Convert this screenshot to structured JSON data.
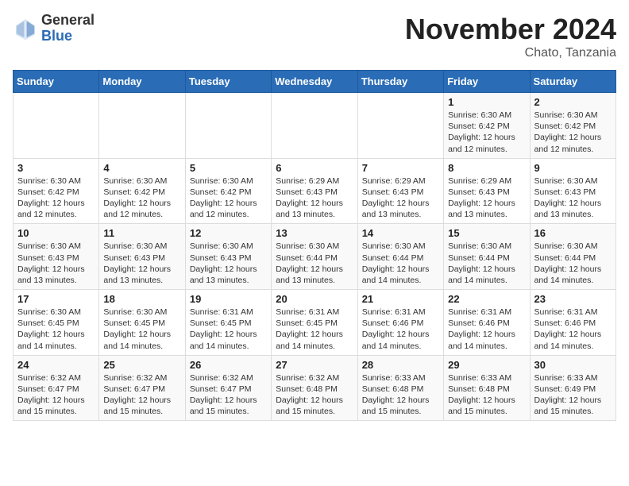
{
  "header": {
    "logo_general": "General",
    "logo_blue": "Blue",
    "month_year": "November 2024",
    "location": "Chato, Tanzania"
  },
  "days_of_week": [
    "Sunday",
    "Monday",
    "Tuesday",
    "Wednesday",
    "Thursday",
    "Friday",
    "Saturday"
  ],
  "weeks": [
    [
      {
        "day": "",
        "info": ""
      },
      {
        "day": "",
        "info": ""
      },
      {
        "day": "",
        "info": ""
      },
      {
        "day": "",
        "info": ""
      },
      {
        "day": "",
        "info": ""
      },
      {
        "day": "1",
        "info": "Sunrise: 6:30 AM\nSunset: 6:42 PM\nDaylight: 12 hours\nand 12 minutes."
      },
      {
        "day": "2",
        "info": "Sunrise: 6:30 AM\nSunset: 6:42 PM\nDaylight: 12 hours\nand 12 minutes."
      }
    ],
    [
      {
        "day": "3",
        "info": "Sunrise: 6:30 AM\nSunset: 6:42 PM\nDaylight: 12 hours\nand 12 minutes."
      },
      {
        "day": "4",
        "info": "Sunrise: 6:30 AM\nSunset: 6:42 PM\nDaylight: 12 hours\nand 12 minutes."
      },
      {
        "day": "5",
        "info": "Sunrise: 6:30 AM\nSunset: 6:42 PM\nDaylight: 12 hours\nand 12 minutes."
      },
      {
        "day": "6",
        "info": "Sunrise: 6:29 AM\nSunset: 6:43 PM\nDaylight: 12 hours\nand 13 minutes."
      },
      {
        "day": "7",
        "info": "Sunrise: 6:29 AM\nSunset: 6:43 PM\nDaylight: 12 hours\nand 13 minutes."
      },
      {
        "day": "8",
        "info": "Sunrise: 6:29 AM\nSunset: 6:43 PM\nDaylight: 12 hours\nand 13 minutes."
      },
      {
        "day": "9",
        "info": "Sunrise: 6:30 AM\nSunset: 6:43 PM\nDaylight: 12 hours\nand 13 minutes."
      }
    ],
    [
      {
        "day": "10",
        "info": "Sunrise: 6:30 AM\nSunset: 6:43 PM\nDaylight: 12 hours\nand 13 minutes."
      },
      {
        "day": "11",
        "info": "Sunrise: 6:30 AM\nSunset: 6:43 PM\nDaylight: 12 hours\nand 13 minutes."
      },
      {
        "day": "12",
        "info": "Sunrise: 6:30 AM\nSunset: 6:43 PM\nDaylight: 12 hours\nand 13 minutes."
      },
      {
        "day": "13",
        "info": "Sunrise: 6:30 AM\nSunset: 6:44 PM\nDaylight: 12 hours\nand 13 minutes."
      },
      {
        "day": "14",
        "info": "Sunrise: 6:30 AM\nSunset: 6:44 PM\nDaylight: 12 hours\nand 14 minutes."
      },
      {
        "day": "15",
        "info": "Sunrise: 6:30 AM\nSunset: 6:44 PM\nDaylight: 12 hours\nand 14 minutes."
      },
      {
        "day": "16",
        "info": "Sunrise: 6:30 AM\nSunset: 6:44 PM\nDaylight: 12 hours\nand 14 minutes."
      }
    ],
    [
      {
        "day": "17",
        "info": "Sunrise: 6:30 AM\nSunset: 6:45 PM\nDaylight: 12 hours\nand 14 minutes."
      },
      {
        "day": "18",
        "info": "Sunrise: 6:30 AM\nSunset: 6:45 PM\nDaylight: 12 hours\nand 14 minutes."
      },
      {
        "day": "19",
        "info": "Sunrise: 6:31 AM\nSunset: 6:45 PM\nDaylight: 12 hours\nand 14 minutes."
      },
      {
        "day": "20",
        "info": "Sunrise: 6:31 AM\nSunset: 6:45 PM\nDaylight: 12 hours\nand 14 minutes."
      },
      {
        "day": "21",
        "info": "Sunrise: 6:31 AM\nSunset: 6:46 PM\nDaylight: 12 hours\nand 14 minutes."
      },
      {
        "day": "22",
        "info": "Sunrise: 6:31 AM\nSunset: 6:46 PM\nDaylight: 12 hours\nand 14 minutes."
      },
      {
        "day": "23",
        "info": "Sunrise: 6:31 AM\nSunset: 6:46 PM\nDaylight: 12 hours\nand 14 minutes."
      }
    ],
    [
      {
        "day": "24",
        "info": "Sunrise: 6:32 AM\nSunset: 6:47 PM\nDaylight: 12 hours\nand 15 minutes."
      },
      {
        "day": "25",
        "info": "Sunrise: 6:32 AM\nSunset: 6:47 PM\nDaylight: 12 hours\nand 15 minutes."
      },
      {
        "day": "26",
        "info": "Sunrise: 6:32 AM\nSunset: 6:47 PM\nDaylight: 12 hours\nand 15 minutes."
      },
      {
        "day": "27",
        "info": "Sunrise: 6:32 AM\nSunset: 6:48 PM\nDaylight: 12 hours\nand 15 minutes."
      },
      {
        "day": "28",
        "info": "Sunrise: 6:33 AM\nSunset: 6:48 PM\nDaylight: 12 hours\nand 15 minutes."
      },
      {
        "day": "29",
        "info": "Sunrise: 6:33 AM\nSunset: 6:48 PM\nDaylight: 12 hours\nand 15 minutes."
      },
      {
        "day": "30",
        "info": "Sunrise: 6:33 AM\nSunset: 6:49 PM\nDaylight: 12 hours\nand 15 minutes."
      }
    ]
  ]
}
